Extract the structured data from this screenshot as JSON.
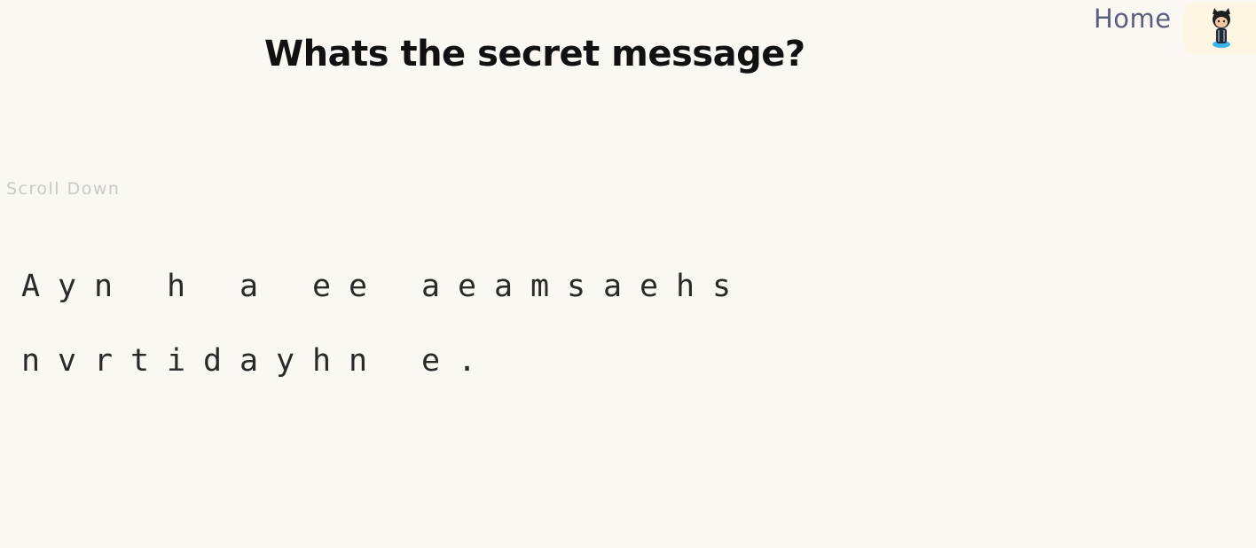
{
  "nav": {
    "home_label": "Home",
    "octocat_icon": "octocat-icon"
  },
  "header": {
    "title": "Whats the secret message?"
  },
  "hint": {
    "scroll_label": "Scroll Down"
  },
  "message": {
    "rows": [
      [
        "A",
        "y",
        "n",
        "",
        "h",
        "",
        "a",
        "",
        "e",
        "e",
        "",
        "a",
        "e",
        "a",
        "m",
        "s",
        "a",
        "e",
        "h",
        "s"
      ],
      [
        "n",
        "v",
        "r",
        "t",
        "i",
        "d",
        "a",
        "y",
        "h",
        "n",
        "",
        "e",
        "."
      ]
    ]
  }
}
